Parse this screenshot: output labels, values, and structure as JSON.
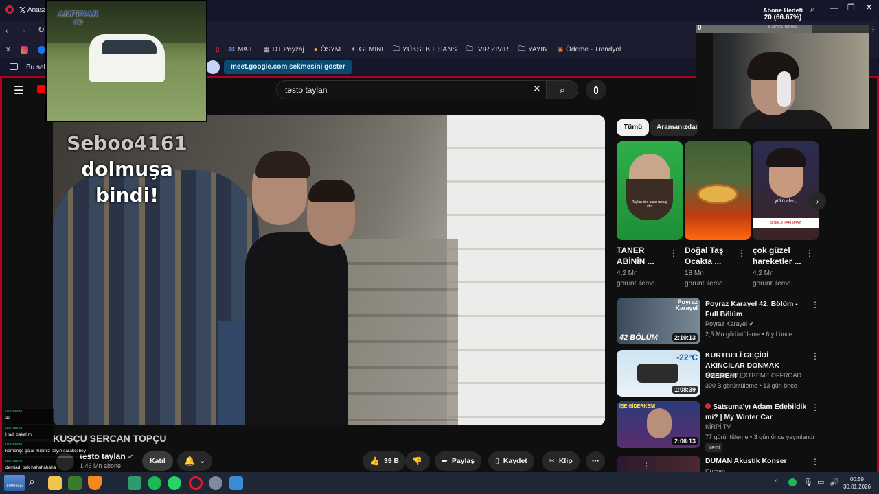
{
  "browser": {
    "tab_title": "Anasay",
    "bookmarks": [
      {
        "label": "MAIL",
        "icon": "mail-icon"
      },
      {
        "label": "DT Peyzaj",
        "icon": "page-icon"
      },
      {
        "label": "ÖSYM",
        "icon": "osym-icon"
      },
      {
        "label": "GEMINI",
        "icon": "gemini-icon"
      },
      {
        "label": "YÜKSEK LİSANS",
        "icon": "folder-icon"
      },
      {
        "label": "IVIR ZIVIR",
        "icon": "folder-icon"
      },
      {
        "label": "YAYIN",
        "icon": "folder-icon"
      },
      {
        "label": "Ödeme - Trendyol",
        "icon": "trendyol-icon"
      }
    ],
    "infobar_left": "Bu sek",
    "infobar_button": "meet.google.com sekmesini göster"
  },
  "youtube": {
    "search_value": "testo taylan",
    "overlay_user": "Seboo4161",
    "overlay_rest": " dolmuşa bindi!",
    "overlay_line2": "bindi!",
    "overlay_line1_tail": "dolmuşa",
    "channel_name": "testo taylan",
    "subscribers": "1,46 Mn abone",
    "join_label": "Katıl",
    "like_count": "39 B",
    "share_label": "Paylaş",
    "save_label": "Kaydet",
    "clip_label": "Klip",
    "lower_title": "KUŞÇU SERCAN TOPÇU"
  },
  "inset": {
    "logo": "AKPINAR",
    "logo_sub": "CD"
  },
  "stream": {
    "goal_title": "Abone Hedefi",
    "goal_value": "20 (66.67%)",
    "goal_sub": "5 DAYS TO GO",
    "goal_left": "0"
  },
  "sidebar": {
    "chips": [
      "Tümü",
      "Aramanızdan"
    ],
    "shorts": [
      {
        "title": "TANER ABİNİN ...",
        "views": "4,2 Mn",
        "unit": "görüntüleme",
        "caption": "Taylan bile bana mesaj attı."
      },
      {
        "title": "Doğal Taş Ocakta ...",
        "views": "18 Mn",
        "unit": "görüntüleme"
      },
      {
        "title": "çok güzel hareketler ...",
        "views": "4,2 Mn",
        "unit": "görüntüleme",
        "caption": "yükü alan,",
        "caption2": "SINGLE YAKIŞMAZ"
      }
    ],
    "videos": [
      {
        "title": "Poyraz Karayel 42. Bölüm - Full Bölüm",
        "channel": "Poyraz Karayel",
        "verified": true,
        "meta": "2,5 Mn görüntüleme • 6 yıl önce",
        "duration": "2:10:13",
        "thumb_text": "42 BÖLÜM",
        "thumb_top": "Poyraz Karayel"
      },
      {
        "title": "KURTBELİ GEÇİDİ AKINCILAR DONMAK ÜZERE!!! ...",
        "channel": "AKINCILAR EXTREME OFFROAD",
        "verified": false,
        "meta": "390 B görüntüleme • 13 gün önce",
        "duration": "1:08:39",
        "thumb_text": "-22°C"
      },
      {
        "title": "Satsuma'yı Adam Edebildik mi? | My Winter Car",
        "channel": "KİRPİ TV",
        "verified": false,
        "meta": "77 görüntüleme • 3 gün önce yayınlandı",
        "badge": "Yeni",
        "duration": "2:06:13",
        "thumb_text": "İŞE GİDERKEN!"
      },
      {
        "title": "DUMAN Akustik Konser",
        "channel": "Duman",
        "verified": true,
        "meta": ""
      }
    ]
  },
  "chat": [
    {
      "name": "username",
      "text": "aa"
    },
    {
      "name": "username",
      "text": "Hadi bakalım"
    },
    {
      "name": "username",
      "text": "kemençe çalar mısınız sayın sarakci bey"
    },
    {
      "name": "username",
      "text": "demiadı bak hahahahaha"
    }
  ],
  "taskbar": {
    "start_label": "1000 kişi",
    "time": "00:59",
    "date": "30.01.2026"
  },
  "colors": {
    "accent_red": "#b0001e",
    "youtube_bg": "#0f0f0f",
    "taskbar": "#1f2736"
  }
}
